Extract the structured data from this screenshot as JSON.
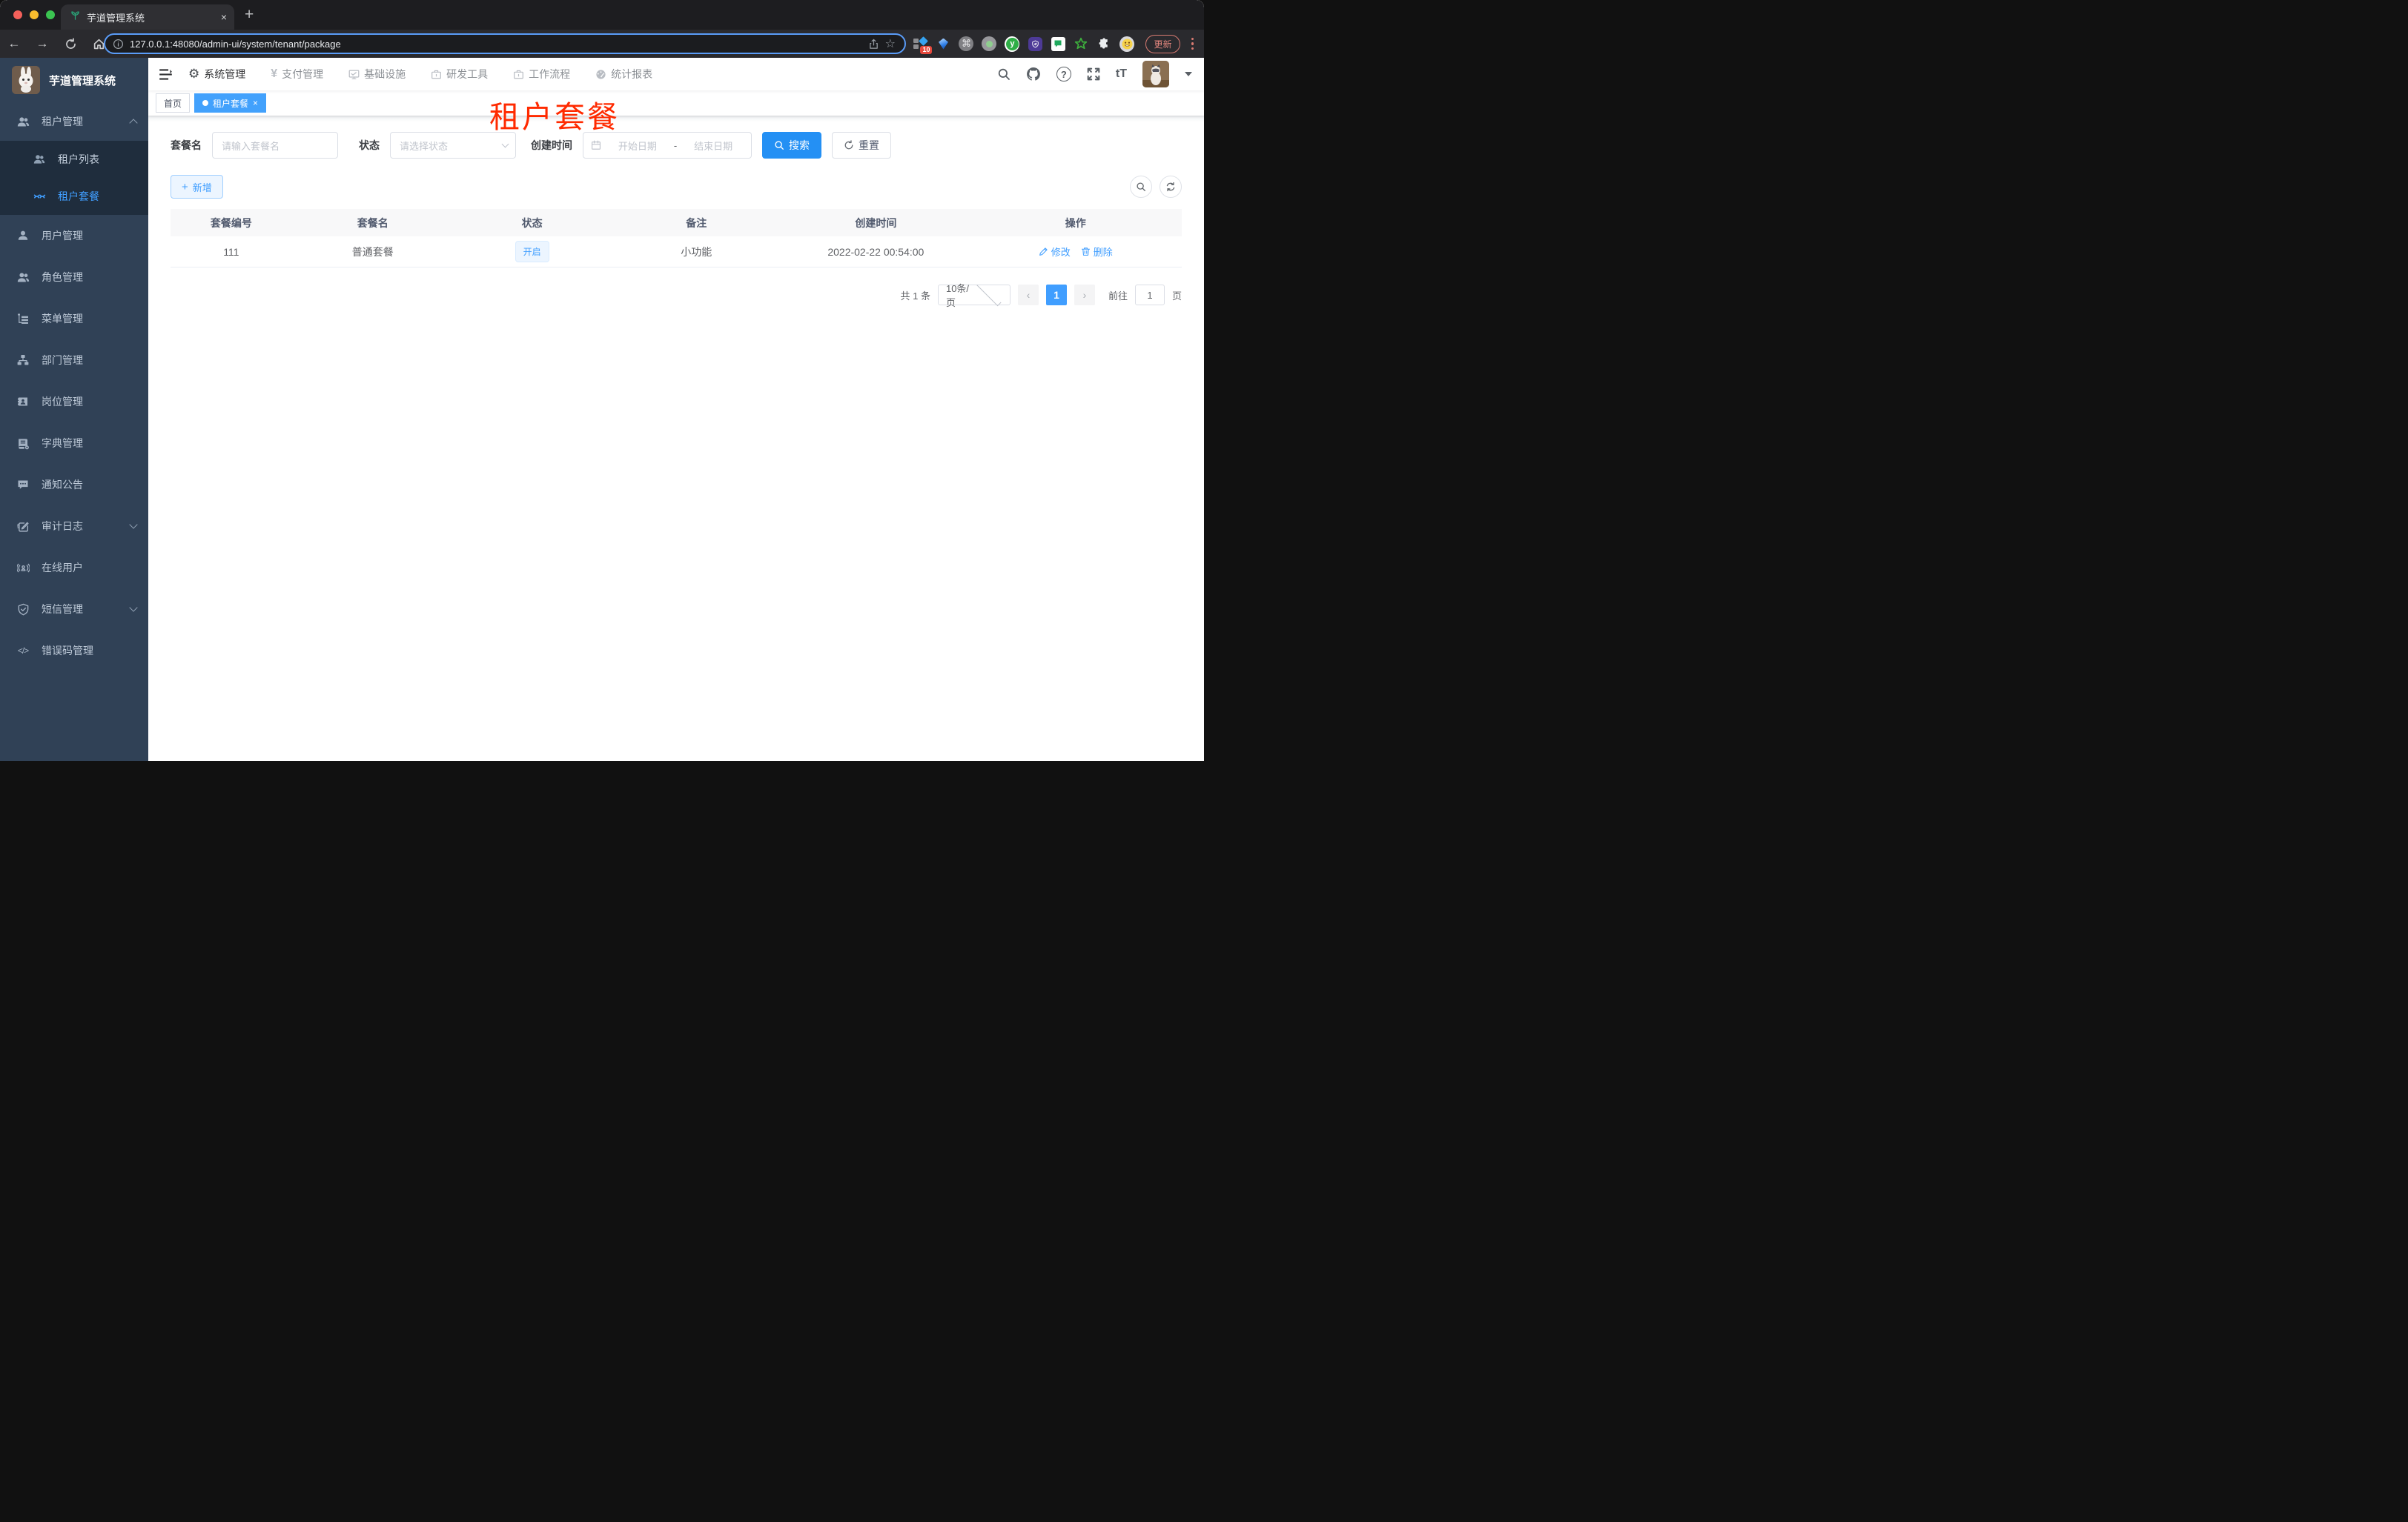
{
  "browser": {
    "tab_title": "芋道管理系统",
    "close_tab_glyph": "×",
    "new_tab_glyph": "+",
    "back_glyph": "←",
    "forward_glyph": "→",
    "url": "127.0.0.1:48080/admin-ui/system/tenant/package",
    "star_glyph": "☆",
    "extensions": {
      "badge_count": "10",
      "command_glyph": "⌘",
      "y_glyph": "y",
      "update_label": "更新"
    }
  },
  "app": {
    "logo_title": "芋道管理系统",
    "top_menu": {
      "items": [
        "系统管理",
        "支付管理",
        "基础设施",
        "研发工具",
        "工作流程",
        "统计报表"
      ]
    },
    "glyphs": {
      "gear": "⚙",
      "yen": "¥",
      "help": "?",
      "font_size": "tT",
      "error_code": "</>",
      "plus": "+",
      "prev": "‹",
      "next": "›"
    },
    "sidebar": {
      "group_label": "租户管理",
      "submenu": [
        "租户列表",
        "租户套餐"
      ],
      "items": [
        "用户管理",
        "角色管理",
        "菜单管理",
        "部门管理",
        "岗位管理",
        "字典管理",
        "通知公告",
        "审计日志",
        "在线用户",
        "短信管理",
        "错误码管理"
      ]
    },
    "tags": {
      "home": "首页",
      "active": "租户套餐",
      "close_glyph": "×"
    },
    "annotation": "租户套餐",
    "filters": {
      "name_label": "套餐名",
      "name_placeholder": "请输入套餐名",
      "status_label": "状态",
      "status_placeholder": "请选择状态",
      "date_label": "创建时间",
      "date_start_placeholder": "开始日期",
      "date_separator": "-",
      "date_end_placeholder": "结束日期",
      "search_label": "搜索",
      "reset_label": "重置",
      "add_label": "新增"
    },
    "table": {
      "headers": [
        "套餐编号",
        "套餐名",
        "状态",
        "备注",
        "创建时间",
        "操作"
      ],
      "rows": [
        {
          "id": "111",
          "name": "普通套餐",
          "status": "开启",
          "remark": "小功能",
          "created": "2022-02-22 00:54:00",
          "edit_label": "修改",
          "delete_label": "删除"
        }
      ]
    },
    "pagination": {
      "total": "共 1 条",
      "page_size": "10条/页",
      "current_page": "1",
      "goto_label": "前往",
      "goto_value": "1",
      "page_unit": "页"
    },
    "colors": {
      "accent": "#409eff",
      "sidebar_bg": "#304156",
      "submenu_bg": "#1f2d3d",
      "annotation_red": "#ff2a00",
      "tag_active": "#42a1fc"
    }
  }
}
